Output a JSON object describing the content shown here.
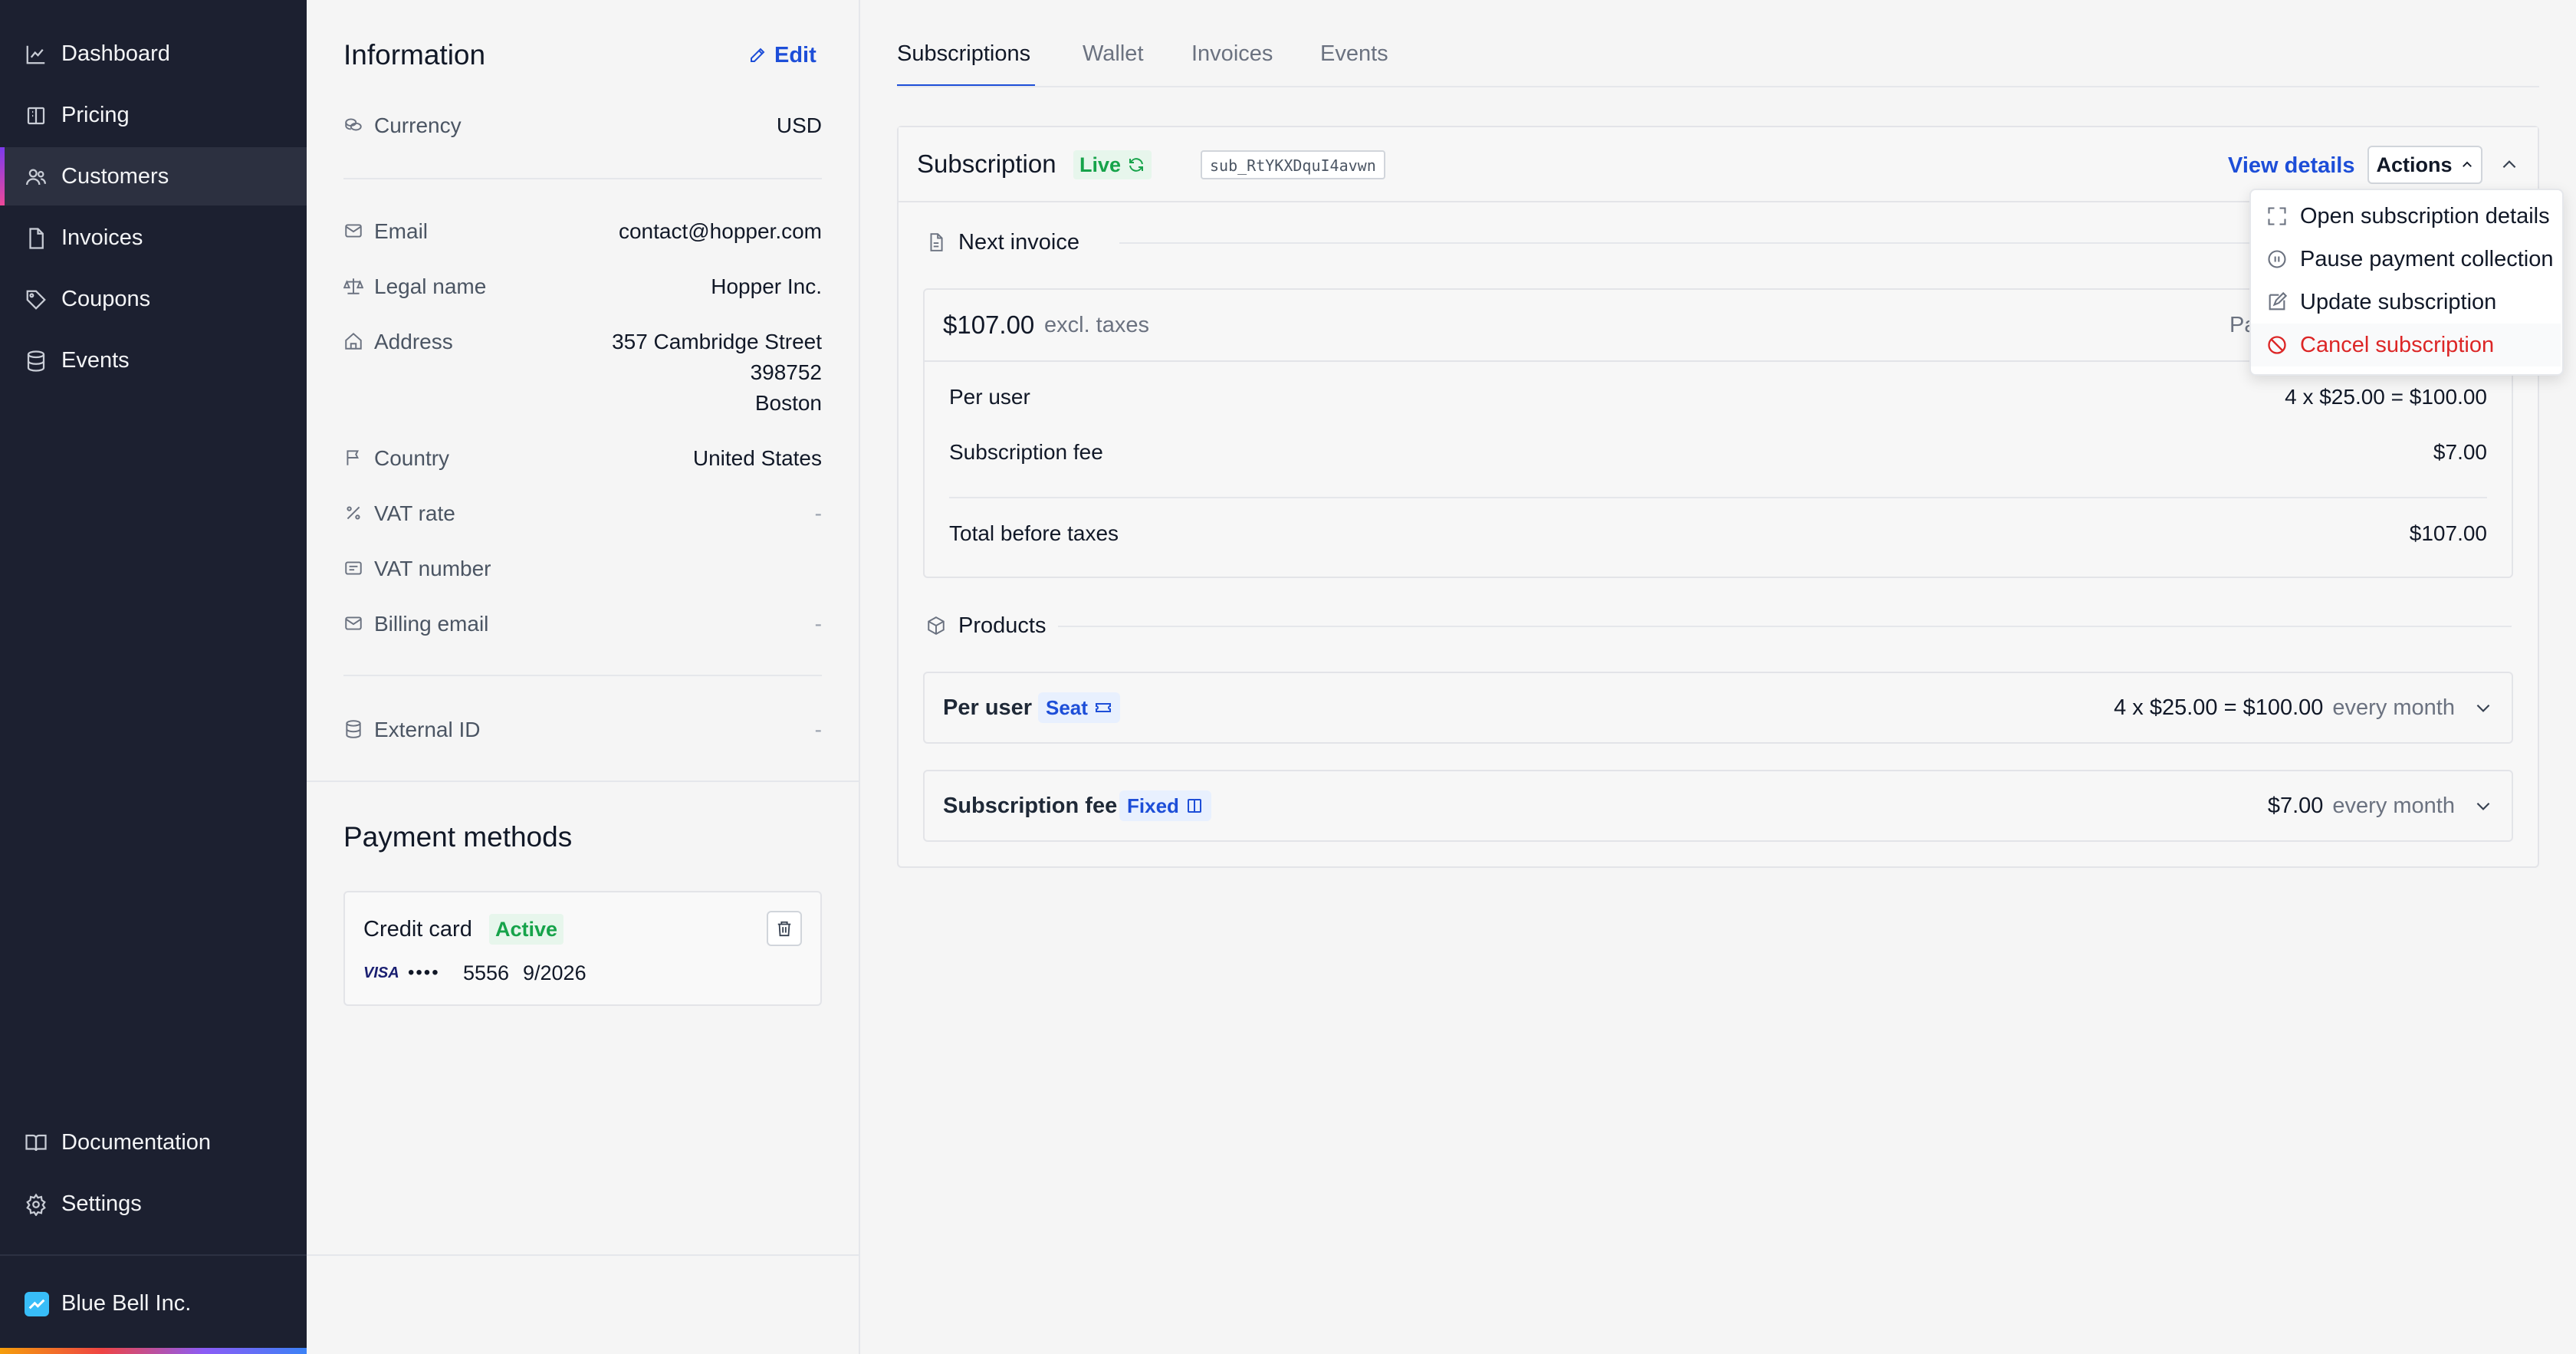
{
  "sidebar": {
    "items": [
      {
        "label": "Dashboard",
        "icon": "chart-line-icon"
      },
      {
        "label": "Pricing",
        "icon": "book-icon"
      },
      {
        "label": "Customers",
        "icon": "users-icon",
        "active": true
      },
      {
        "label": "Invoices",
        "icon": "file-icon"
      },
      {
        "label": "Coupons",
        "icon": "tag-icon"
      },
      {
        "label": "Events",
        "icon": "database-icon"
      }
    ],
    "footer_items": [
      {
        "label": "Documentation",
        "icon": "book-open-icon"
      },
      {
        "label": "Settings",
        "icon": "gear-icon"
      }
    ],
    "org_name": "Blue Bell Inc."
  },
  "info": {
    "title": "Information",
    "edit_label": "Edit",
    "currency_label": "Currency",
    "currency_value": "USD",
    "email_label": "Email",
    "email_value": "contact@hopper.com",
    "legal_name_label": "Legal name",
    "legal_name_value": "Hopper Inc.",
    "address_label": "Address",
    "address_line1": "357 Cambridge Street",
    "address_line2": "398752",
    "address_line3": "Boston",
    "country_label": "Country",
    "country_value": "United States",
    "vat_rate_label": "VAT rate",
    "vat_rate_value": "-",
    "vat_number_label": "VAT number",
    "billing_email_label": "Billing email",
    "billing_email_value": "-",
    "external_id_label": "External ID",
    "external_id_value": "-"
  },
  "payment": {
    "title": "Payment methods",
    "card_type": "Credit card",
    "status": "Active",
    "brand": "VISA",
    "dots": "••••",
    "last4": "5556",
    "expiry": "9/2026"
  },
  "tabs": [
    "Subscriptions",
    "Wallet",
    "Invoices",
    "Events"
  ],
  "subscription": {
    "title": "Subscription",
    "status": "Live",
    "id": "sub_RtYKXDquI4avwn",
    "view_details": "View details",
    "actions_label": "Actions",
    "next_invoice_label": "Next invoice",
    "amount": "$107.00",
    "excl_taxes": "excl. taxes",
    "partial_text": "Pa",
    "lines": [
      {
        "label": "Per user",
        "value": "4 x $25.00 = $100.00"
      },
      {
        "label": "Subscription fee",
        "value": "$7.00"
      }
    ],
    "total_label": "Total before taxes",
    "total_value": "$107.00",
    "products_label": "Products",
    "products": [
      {
        "name": "Per user",
        "tag": "Seat",
        "price": "4 x $25.00 = $100.00",
        "period": "every month"
      },
      {
        "name": "Subscription fee",
        "tag": "Fixed",
        "price": "$7.00",
        "period": "every month"
      }
    ]
  },
  "actions_menu": [
    {
      "label": "Open subscription details",
      "icon": "expand-icon"
    },
    {
      "label": "Pause payment collection",
      "icon": "pause-icon"
    },
    {
      "label": "Update subscription",
      "icon": "edit-icon"
    },
    {
      "label": "Cancel subscription",
      "icon": "ban-icon",
      "color": "#dc2626"
    }
  ],
  "colors": {
    "sidebar_bg": "#1c2030",
    "accent_blue": "#1d4ed8",
    "live_green": "#16a34a",
    "danger_red": "#dc2626"
  }
}
